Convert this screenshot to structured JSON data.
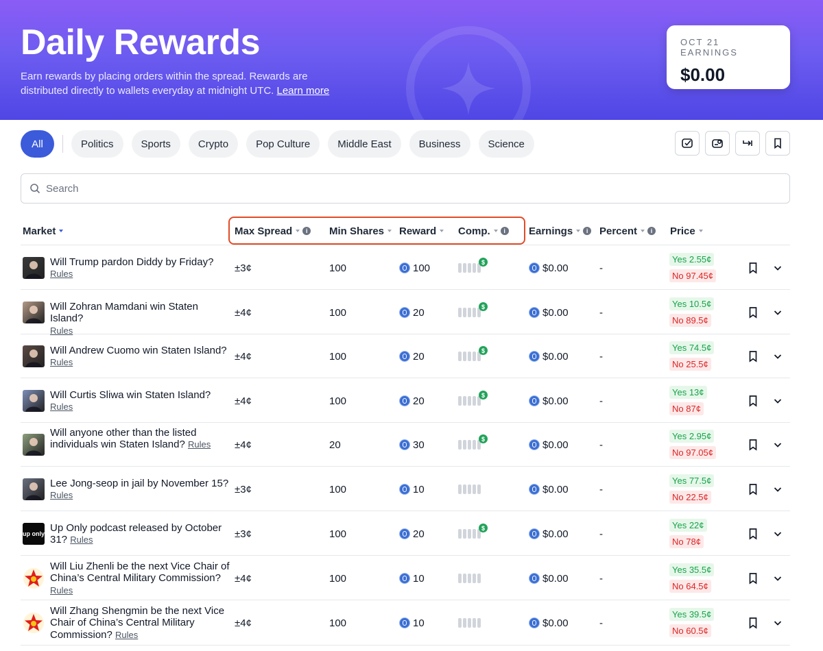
{
  "header": {
    "title": "Daily Rewards",
    "description": "Earn rewards by placing orders within the spread. Rewards are distributed directly to wallets everyday at midnight UTC.",
    "learn_more": "Learn more",
    "earnings_label": "OCT 21 EARNINGS",
    "earnings_value": "$0.00"
  },
  "filters": [
    "All",
    "Politics",
    "Sports",
    "Crypto",
    "Pop Culture",
    "Middle East",
    "Business",
    "Science"
  ],
  "toolbar_icons": [
    "checkbox-icon",
    "wallet-check-icon",
    "arrow-right-icon",
    "bookmark-icon"
  ],
  "search": {
    "placeholder": "Search"
  },
  "columns": {
    "market": "Market",
    "max_spread": "Max Spread",
    "min_shares": "Min Shares",
    "reward": "Reward",
    "comp": "Comp.",
    "earnings": "Earnings",
    "percent": "Percent",
    "price": "Price"
  },
  "rows": [
    {
      "title": "Will Trump pardon Diddy by Friday?",
      "rules": "Rules",
      "spread": "±3¢",
      "shares": "100",
      "reward": "100",
      "comp_reward": true,
      "earnings": "$0.00",
      "percent": "-",
      "yes": "Yes 2.55¢",
      "no": "No 97.45¢",
      "thumb_color": "#3a3a3a"
    },
    {
      "title": "Will Zohran Mamdani win Staten Island?",
      "rules": "Rules",
      "spread": "±4¢",
      "shares": "100",
      "reward": "20",
      "comp_reward": true,
      "earnings": "$0.00",
      "percent": "-",
      "yes": "Yes 10.5¢",
      "no": "No 89.5¢",
      "thumb_color": "#b49a86"
    },
    {
      "title": "Will Andrew Cuomo win Staten Island?",
      "rules": "Rules",
      "spread": "±4¢",
      "shares": "100",
      "reward": "20",
      "comp_reward": true,
      "earnings": "$0.00",
      "percent": "-",
      "yes": "Yes 74.5¢",
      "no": "No 25.5¢",
      "thumb_color": "#5b4a44"
    },
    {
      "title": "Will Curtis Sliwa win Staten Island?",
      "rules": "Rules",
      "spread": "±4¢",
      "shares": "100",
      "reward": "20",
      "comp_reward": true,
      "earnings": "$0.00",
      "percent": "-",
      "yes": "Yes 13¢",
      "no": "No 87¢",
      "thumb_color": "#7d8eb8"
    },
    {
      "title": "Will anyone other than the listed individuals win Staten Island?",
      "rules": "Rules",
      "spread": "±4¢",
      "shares": "20",
      "reward": "30",
      "comp_reward": true,
      "earnings": "$0.00",
      "percent": "-",
      "yes": "Yes 2.95¢",
      "no": "No 97.05¢",
      "thumb_color": "#8ea07e"
    },
    {
      "title": "Lee Jong-seop in jail by November 15?",
      "rules": "Rules",
      "spread": "±3¢",
      "shares": "100",
      "reward": "10",
      "comp_reward": false,
      "earnings": "$0.00",
      "percent": "-",
      "yes": "Yes 77.5¢",
      "no": "No 22.5¢",
      "thumb_color": "#6a7080"
    },
    {
      "title": "Up Only podcast released by October 31?",
      "rules": "Rules",
      "spread": "±3¢",
      "shares": "100",
      "reward": "20",
      "comp_reward": true,
      "earnings": "$0.00",
      "percent": "-",
      "yes": "Yes 22¢",
      "no": "No 78¢",
      "thumb_color": "#0a0a0a",
      "thumb_text": "up only"
    },
    {
      "title": "Will Liu Zhenli be the next Vice Chair of China’s Central Military Commission?",
      "rules": "Rules",
      "spread": "±4¢",
      "shares": "100",
      "reward": "10",
      "comp_reward": false,
      "earnings": "$0.00",
      "percent": "-",
      "yes": "Yes 35.5¢",
      "no": "No 64.5¢",
      "thumb_color": "star"
    },
    {
      "title": "Will Zhang Shengmin be the next Vice Chair of China’s Central Military Commission?",
      "rules": "Rules",
      "spread": "±4¢",
      "shares": "100",
      "reward": "10",
      "comp_reward": false,
      "earnings": "$0.00",
      "percent": "-",
      "yes": "Yes 39.5¢",
      "no": "No 60.5¢",
      "thumb_color": "star"
    }
  ]
}
